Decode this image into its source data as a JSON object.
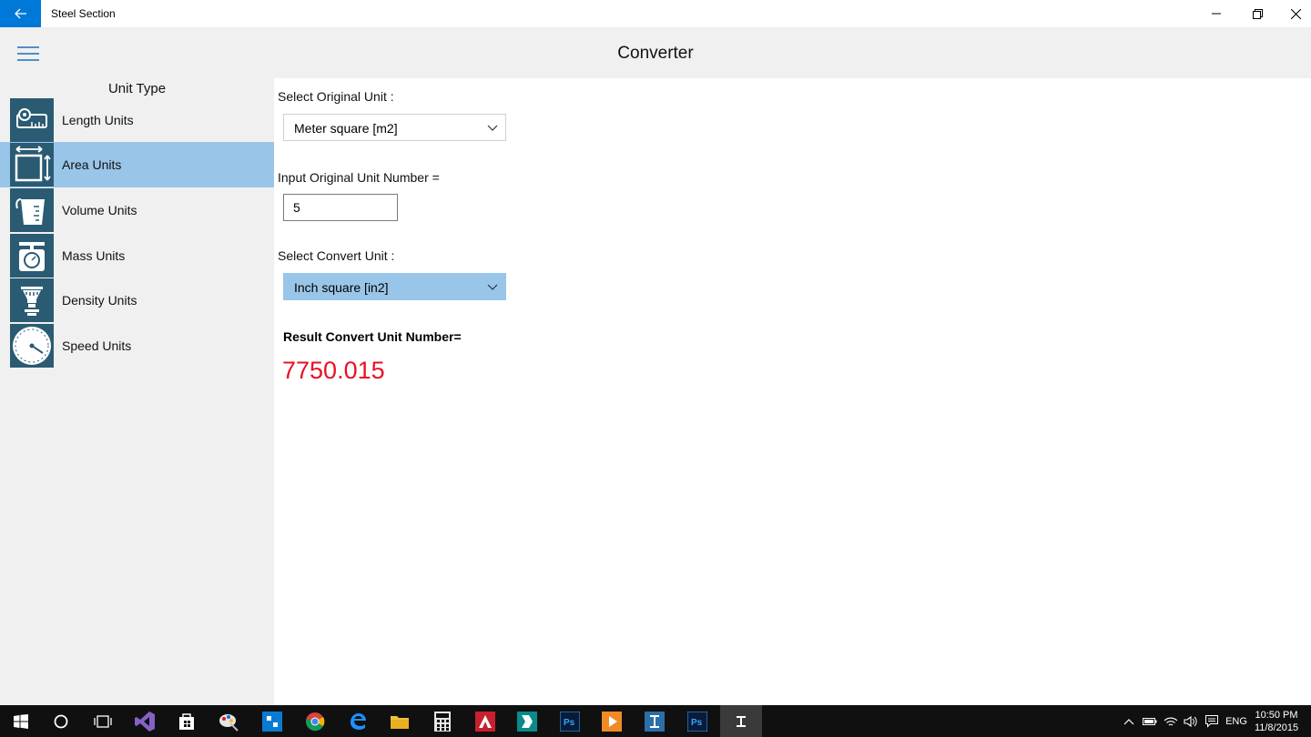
{
  "window": {
    "title": "Steel Section"
  },
  "header": {
    "title": "Converter"
  },
  "sidebar": {
    "heading": "Unit Type",
    "items": [
      {
        "label": "Length  Units",
        "icon": "tape-measure-icon"
      },
      {
        "label": "Area Units",
        "icon": "area-icon",
        "selected": true
      },
      {
        "label": "Volume Units",
        "icon": "measuring-cup-icon"
      },
      {
        "label": "Mass Units",
        "icon": "scale-icon"
      },
      {
        "label": "Density Units",
        "icon": "funnel-icon"
      },
      {
        "label": "Speed Units",
        "icon": "speedometer-icon"
      }
    ]
  },
  "main": {
    "original_unit_label": "Select Original Unit :",
    "original_unit_value": "Meter square [m2]",
    "input_label": "Input Original Unit Number =",
    "input_value": "5",
    "convert_unit_label": "Select Convert Unit :",
    "convert_unit_value": "Inch square [in2]",
    "result_label": "Result Convert Unit Number=",
    "result_value": "7750.015"
  },
  "taskbar": {
    "time": "10:50 PM",
    "date": "11/8/2015",
    "language": "ENG"
  },
  "colors": {
    "accent": "#0078d7",
    "selected_item": "#99c5e9",
    "icon_bg": "#2a5b73",
    "result": "#e81123",
    "sidebar_bg": "#f0f0f0"
  }
}
